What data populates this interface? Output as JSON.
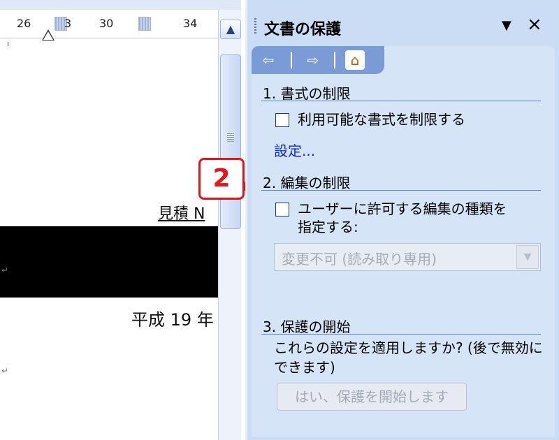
{
  "ruler": {
    "numbers": [
      "26",
      "30",
      "34"
    ],
    "marker_text": "3"
  },
  "document": {
    "estimate_text": "見積 N",
    "date_text": "平成 19 年",
    "para_mark": "↵"
  },
  "callout": {
    "number": "2"
  },
  "scrollbar": {
    "up_arrow": "▲"
  },
  "pane": {
    "title": "文書の保護",
    "dropdown_icon": "▼",
    "close_icon": "×",
    "nav": {
      "back": "⇦",
      "forward": "⇨",
      "home": "⌂"
    },
    "section1": {
      "heading": "1. 書式の制限",
      "checkbox_label": "利用可能な書式を制限する",
      "settings_link": "設定..."
    },
    "section2": {
      "heading": "2. 編集の制限",
      "checkbox_label_line1": "ユーザーに許可する編集の種類を",
      "checkbox_label_line2": "指定する:",
      "select_value": "変更不可 (読み取り専用)",
      "select_arrow": "▼"
    },
    "section3": {
      "heading": "3. 保護の開始",
      "description": "これらの設定を適用しますか? (後で無効にできます)",
      "start_button": "はい、保護を開始します"
    }
  }
}
